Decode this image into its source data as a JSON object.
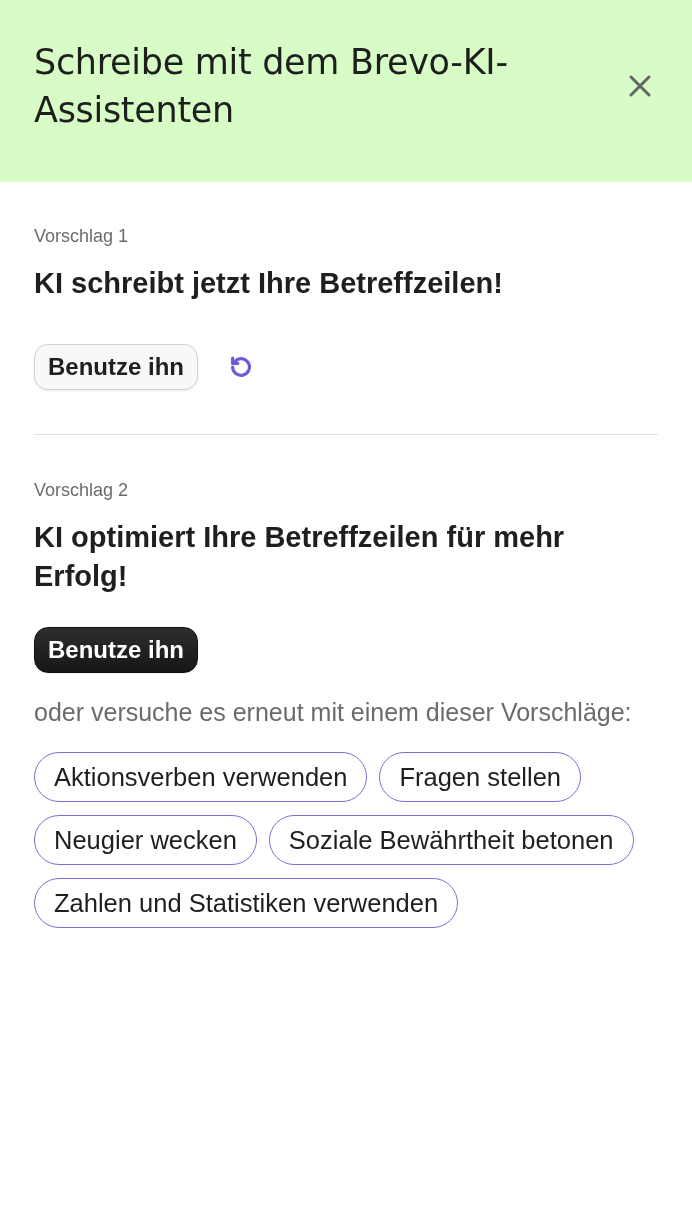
{
  "header": {
    "title": "Schreibe mit dem Brevo-KI-Assistenten"
  },
  "suggestions": [
    {
      "label": "Vorschlag 1",
      "text": "KI schreibt jetzt Ihre Betreffzeilen!",
      "button": "Benutze ihn",
      "primary": false,
      "regenerate": true
    },
    {
      "label": "Vorschlag 2",
      "text": "KI optimiert Ihre Betreffzeilen für mehr Erfolg!",
      "button": "Benutze ihn",
      "primary": true,
      "regenerate": false
    }
  ],
  "retry_prompt": "oder versuche es erneut mit einem dieser Vorschläge:",
  "chips": [
    "Aktionsverben verwenden",
    "Fragen stellen",
    "Neugier wecken",
    "Soziale Bewährtheit betonen",
    "Zahlen und Statistiken verwenden"
  ]
}
